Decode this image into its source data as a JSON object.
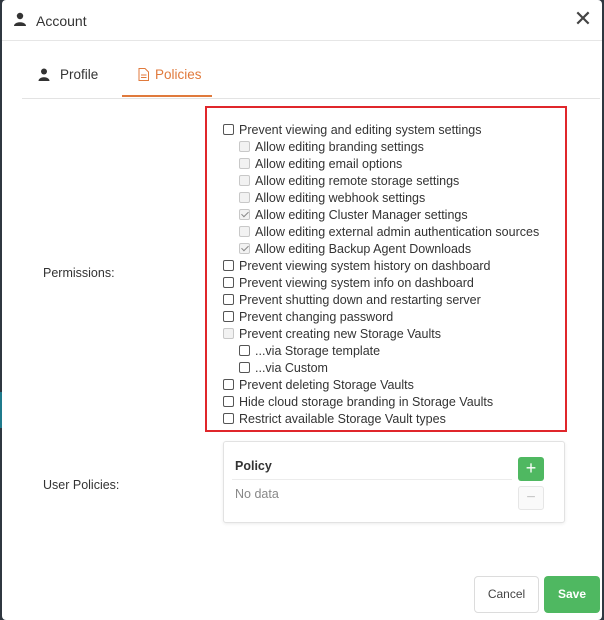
{
  "dialog": {
    "title": "Account",
    "close_icon": "close-icon"
  },
  "tabs": [
    {
      "label": "Profile",
      "icon": "user-icon",
      "active": false
    },
    {
      "label": "Policies",
      "icon": "document-icon",
      "active": true
    }
  ],
  "permissions": {
    "label": "Permissions:",
    "items": [
      {
        "label": "Prevent viewing and editing system settings",
        "checked": false,
        "disabled": false,
        "level": 0
      },
      {
        "label": "Allow editing branding settings",
        "checked": false,
        "disabled": true,
        "level": 1
      },
      {
        "label": "Allow editing email options",
        "checked": false,
        "disabled": true,
        "level": 1
      },
      {
        "label": "Allow editing remote storage settings",
        "checked": false,
        "disabled": true,
        "level": 1
      },
      {
        "label": "Allow editing webhook settings",
        "checked": false,
        "disabled": true,
        "level": 1
      },
      {
        "label": "Allow editing Cluster Manager settings",
        "checked": true,
        "disabled": true,
        "level": 1
      },
      {
        "label": "Allow editing external admin authentication sources",
        "checked": false,
        "disabled": true,
        "level": 1
      },
      {
        "label": "Allow editing Backup Agent Downloads",
        "checked": true,
        "disabled": true,
        "level": 1
      },
      {
        "label": "Prevent viewing system history on dashboard",
        "checked": false,
        "disabled": false,
        "level": 0
      },
      {
        "label": "Prevent viewing system info on dashboard",
        "checked": false,
        "disabled": false,
        "level": 0
      },
      {
        "label": "Prevent shutting down and restarting server",
        "checked": false,
        "disabled": false,
        "level": 0
      },
      {
        "label": "Prevent changing password",
        "checked": false,
        "disabled": false,
        "level": 0
      },
      {
        "label": "Prevent creating new Storage Vaults",
        "checked": false,
        "disabled": true,
        "level": 0
      },
      {
        "label": "...via Storage template",
        "checked": false,
        "disabled": false,
        "level": 1
      },
      {
        "label": "...via Custom",
        "checked": false,
        "disabled": false,
        "level": 1
      },
      {
        "label": "Prevent deleting Storage Vaults",
        "checked": false,
        "disabled": false,
        "level": 0
      },
      {
        "label": "Hide cloud storage branding in Storage Vaults",
        "checked": false,
        "disabled": false,
        "level": 0
      },
      {
        "label": "Restrict available Storage Vault types",
        "checked": false,
        "disabled": false,
        "level": 0
      }
    ]
  },
  "user_policies": {
    "label": "User Policies:",
    "column_header": "Policy",
    "empty_text": "No data",
    "add_label": "+",
    "remove_label": "−"
  },
  "footer": {
    "cancel_label": "Cancel",
    "save_label": "Save"
  },
  "colors": {
    "accent": "#e07a3c",
    "primary": "#4fb861",
    "highlight_border": "#e0262b"
  }
}
